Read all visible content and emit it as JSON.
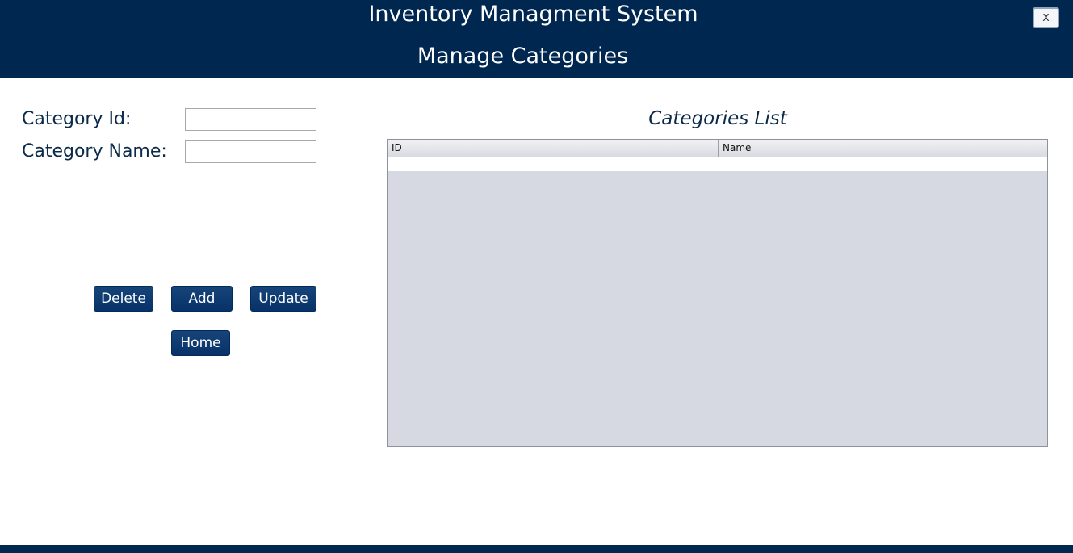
{
  "header": {
    "app_title": "Inventory Managment System",
    "page_title": "Manage Categories",
    "close_label": "X"
  },
  "form": {
    "category_id_label": "Category Id:",
    "category_id_value": "",
    "category_name_label": "Category Name:",
    "category_name_value": ""
  },
  "buttons": {
    "delete": "Delete",
    "add": "Add",
    "update": "Update",
    "home": "Home"
  },
  "table": {
    "title": "Categories List",
    "columns": [
      "ID",
      "Name"
    ],
    "rows": []
  },
  "colors": {
    "brand": "#00274f",
    "button": "#0a3a70",
    "table_empty": "#d6d9e1"
  }
}
